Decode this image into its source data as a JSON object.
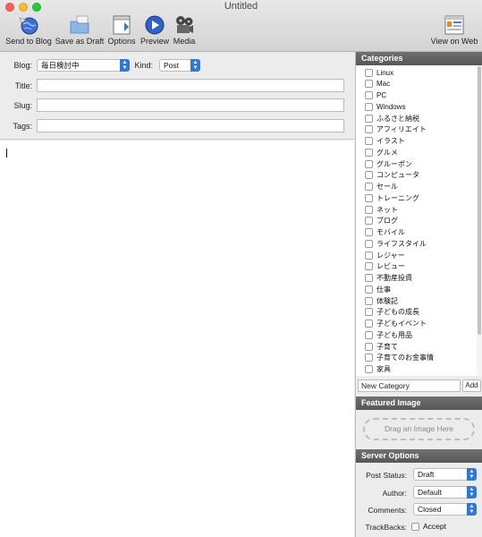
{
  "window": {
    "title": "Untitled"
  },
  "toolbar": {
    "send_to_blog": "Send to Blog",
    "save_as_draft": "Save as Draft",
    "options": "Options",
    "preview": "Preview",
    "media": "Media",
    "view_on_web": "View on Web"
  },
  "meta": {
    "blog_label": "Blog:",
    "blog_value": "毎日検討中",
    "kind_label": "Kind:",
    "kind_value": "Post",
    "title_label": "Title:",
    "slug_label": "Slug:",
    "tags_label": "Tags:"
  },
  "categories": {
    "heading": "Categories",
    "items": [
      "Linux",
      "Mac",
      "PC",
      "Windows",
      "ふるさと納税",
      "アフィリエイト",
      "イラスト",
      "グルメ",
      "グルーポン",
      "コンピュータ",
      "セール",
      "トレーニング",
      "ネット",
      "ブログ",
      "モバイル",
      "ライフスタイル",
      "レジャー",
      "レビュー",
      "不動産投資",
      "仕事",
      "体験記",
      "子どもの成長",
      "子どもイベント",
      "子ども用品",
      "子育て",
      "子育てのお金事情",
      "家具"
    ],
    "new_category_value": "New Category",
    "add_label": "Add"
  },
  "featured_image": {
    "heading": "Featured Image",
    "drop_label": "Drag an Image Here"
  },
  "server_options": {
    "heading": "Server Options",
    "post_status_label": "Post Status:",
    "post_status_value": "Draft",
    "author_label": "Author:",
    "author_value": "Default",
    "comments_label": "Comments:",
    "comments_value": "Closed",
    "trackbacks_label": "TrackBacks:",
    "accept_label": "Accept"
  },
  "colors": {
    "accent": "#2e78d8",
    "section_header": "#5f5f5f"
  }
}
